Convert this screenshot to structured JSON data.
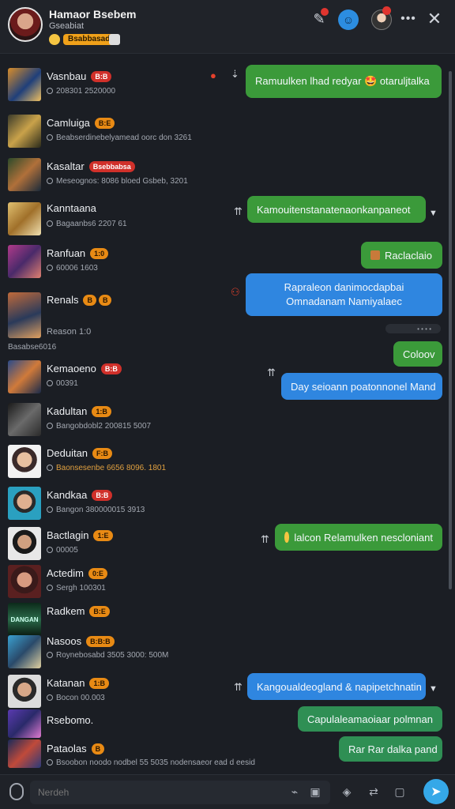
{
  "header": {
    "title": "Hamaor Bsebem",
    "subtitle": "Gseabiat",
    "status_chip": "Bsabbasad",
    "close_label": "✕",
    "more_label": "•••"
  },
  "chats": [
    {
      "name": "Vasnbau",
      "badge": "B:B",
      "badge_color": "red",
      "meta": "208301 2520000"
    },
    {
      "name": "Camluiga",
      "badge": "B:E",
      "badge_color": "orange",
      "meta": "Beabserdinebelyamead oorc don 3261"
    },
    {
      "name": "Kasaltar",
      "badge": "Bsebbabsa",
      "badge_color": "red",
      "meta": "Meseognos: 8086 bloed Gsbeb, 3201"
    },
    {
      "name": "Kanntaana",
      "badge": "",
      "badge_color": "",
      "meta": "Bagaanbs6 2207 61"
    },
    {
      "name": "Ranfuan",
      "badge": "1:0",
      "badge_color": "orange",
      "meta": "60006 1603"
    },
    {
      "name": "Renals",
      "badge": "B",
      "badge_color": "orange",
      "meta": "Renson"
    },
    {
      "name": "Kemaoeno",
      "badge": "B:B",
      "badge_color": "red",
      "meta": "00391"
    },
    {
      "name": "Kadultan",
      "badge": "1:B",
      "badge_color": "orange",
      "meta": "Bangobdobl2 200815 5007"
    },
    {
      "name": "Deduitan",
      "badge": "F:B",
      "badge_color": "orange",
      "meta": "Baonsesenbe 6656 8096. 1801"
    },
    {
      "name": "Kandkaa",
      "badge": "B:B",
      "badge_color": "red",
      "meta": "Bangon 380000015 3913"
    },
    {
      "name": "Bactlagin",
      "badge": "1:E",
      "badge_color": "orange",
      "meta": "00005"
    },
    {
      "name": "Actedim",
      "badge": "0:E",
      "badge_color": "orange",
      "meta": "Sergh 100301"
    },
    {
      "name": "Radkem",
      "badge": "B:E",
      "badge_color": "orange",
      "meta": ""
    },
    {
      "name": "Nasoos",
      "badge": "B:B:B",
      "badge_color": "orange",
      "meta": "Roynebosabd 3505 3000: 500M"
    },
    {
      "name": "Katanan",
      "badge": "1:B",
      "badge_color": "orange",
      "meta": "Bocon 00.003"
    },
    {
      "name": "Rsebomo.",
      "badge": "",
      "badge_color": "",
      "meta": ""
    },
    {
      "name": "Pataolas",
      "badge": "B",
      "badge_color": "orange",
      "meta": "Bsoobon noodo nodbel 55 5035 nodensaeor ead d eesid"
    }
  ],
  "extra_meta": [
    "Reason 1:0",
    "Basabse6016"
  ],
  "messages": [
    {
      "text": "Ramuulken lhad redyar 🤩 otaruljtalka",
      "color": "green"
    },
    {
      "text": "Kamouitenstanatenaonkanpaneot",
      "color": "green"
    },
    {
      "text": "Raclaclaio",
      "color": "green"
    },
    {
      "text": "Rapraleon danimocdapbai Omnadanam Namiyalaec",
      "color": "blue"
    },
    {
      "text": "Coloov",
      "color": "green"
    },
    {
      "text": "Day seioann poatonnonel Mand",
      "color": "blue"
    },
    {
      "text": "lalcon Relamulken nescloniant",
      "color": "green"
    },
    {
      "text": "Kangoualdeogland & napipetchnatin",
      "color": "blue"
    },
    {
      "text": "Capulaleamaoiaar polmnan",
      "color": "tealgreen"
    },
    {
      "text": "Rar Rar dalka pand",
      "color": "tealgreen"
    }
  ],
  "composer": {
    "placeholder": "Nerdeh"
  },
  "icons": [
    "pencil-icon",
    "face-icon",
    "user-icon",
    "more-icon",
    "close-icon",
    "paperclip-icon",
    "attach-icon",
    "format-icon",
    "shield-icon",
    "swap-icon",
    "image-icon",
    "send-icon"
  ],
  "colors": {
    "background": "#1b1e24",
    "green": "#3b9a3a",
    "blue": "#2f86e0",
    "tealgreen": "#2f8f54",
    "send": "#35a8e8",
    "badge_red": "#d0302a",
    "badge_orange": "#e88a14"
  }
}
